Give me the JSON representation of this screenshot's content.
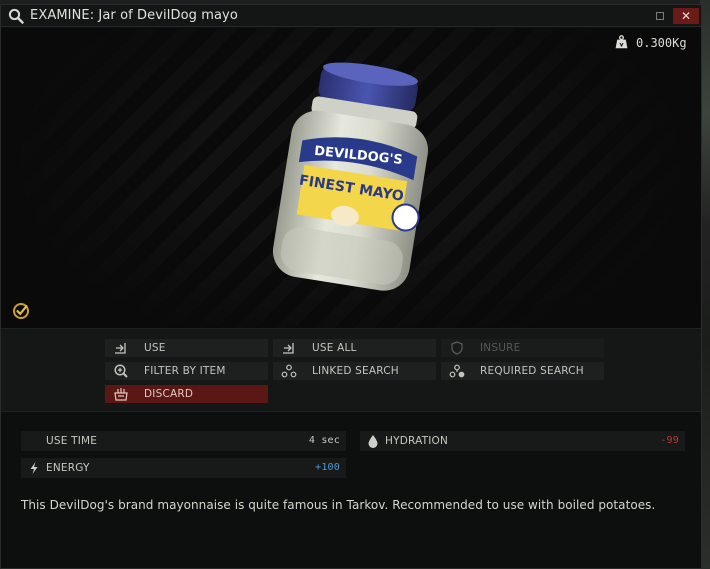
{
  "window": {
    "title": "EXAMINE: Jar of DevilDog mayo",
    "icon": "magnifier-icon"
  },
  "item": {
    "weight": "0.300Kg",
    "image_label_brand": "DEVILDOG'S",
    "image_label_product": "FINEST MAYO"
  },
  "actions": [
    {
      "label": "USE",
      "icon": "use-icon",
      "enabled": true
    },
    {
      "label": "USE ALL",
      "icon": "use-all-icon",
      "enabled": true
    },
    {
      "label": "INSURE",
      "icon": "shield-icon",
      "enabled": false
    },
    {
      "label": "FILTER BY ITEM",
      "icon": "zoom-plus-icon",
      "enabled": true
    },
    {
      "label": "LINKED SEARCH",
      "icon": "linked-search-icon",
      "enabled": true
    },
    {
      "label": "REQUIRED SEARCH",
      "icon": "required-search-icon",
      "enabled": true
    },
    {
      "label": "DISCARD",
      "icon": "discard-icon",
      "enabled": true
    }
  ],
  "stats": [
    {
      "label": "USE TIME",
      "value": "4 sec",
      "icon": "",
      "color": "#c8c8c2"
    },
    {
      "label": "HYDRATION",
      "value": "-99",
      "icon": "water-drop-icon",
      "color": "#b83a32"
    },
    {
      "label": "ENERGY",
      "value": "+100",
      "icon": "lightning-icon",
      "color": "#4f9ad6"
    }
  ],
  "description": "This DevilDog's brand mayonnaise is quite famous in Tarkov. Recommended to use with boiled potatoes.",
  "colors": {
    "accent_positive": "#4f9ad6",
    "accent_negative": "#b83a32",
    "discard_bg": "#5a1714",
    "examined_check": "#c9a227"
  }
}
